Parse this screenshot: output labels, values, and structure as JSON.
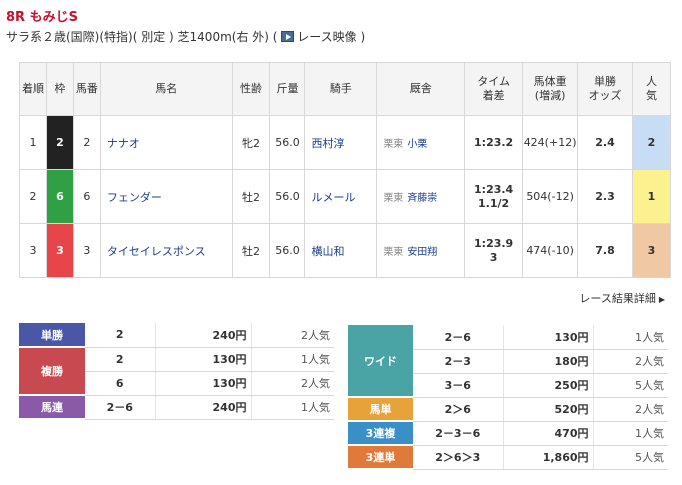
{
  "race": {
    "title": "8R もみじS",
    "conditions": "サラ系２歳(国際)(特指)( 別定 ) 芝1400m(右 外)  (",
    "video_label": "レース映像",
    "conditions_close": " )"
  },
  "table": {
    "headers": {
      "rank": "着順",
      "waku": "枠",
      "umaban": "馬番",
      "name": "馬名",
      "sexage": "性齢",
      "weight": "斤量",
      "jockey": "騎手",
      "trainer": "厩舎",
      "time1": "タイム",
      "time2": "着差",
      "bodyweight1": "馬体重",
      "bodyweight2": "(増減)",
      "odds1": "単勝",
      "odds2": "オッズ",
      "pop1": "人",
      "pop2": "気"
    },
    "rows": [
      {
        "rank": "1",
        "waku": "2",
        "waku_color": "#222222",
        "umaban": "2",
        "name": "ナナオ",
        "sexage": "牝2",
        "weight": "56.0",
        "jockey": "西村淳",
        "belong": "栗東",
        "trainer": "小栗",
        "time": "1:23.2",
        "margin": "",
        "bodyweight": "424(+12)",
        "odds": "2.4",
        "pop": "2",
        "pop_bg": "#c7dcf5"
      },
      {
        "rank": "2",
        "waku": "6",
        "waku_color": "#2fa043",
        "umaban": "6",
        "name": "フェンダー",
        "sexage": "牡2",
        "weight": "56.0",
        "jockey": "ルメール",
        "belong": "栗東",
        "trainer": "斉藤崇",
        "time": "1:23.4",
        "margin": "1.1/2",
        "bodyweight": "504(-12)",
        "odds": "2.3",
        "pop": "1",
        "pop_bg": "#fbf18f"
      },
      {
        "rank": "3",
        "waku": "3",
        "waku_color": "#e8454b",
        "umaban": "3",
        "name": "タイセイレスポンス",
        "sexage": "牡2",
        "weight": "56.0",
        "jockey": "横山和",
        "belong": "栗東",
        "trainer": "安田翔",
        "time": "1:23.9",
        "margin": "3",
        "bodyweight": "474(-10)",
        "odds": "7.8",
        "pop": "3",
        "pop_bg": "#f0c8a4"
      }
    ]
  },
  "detail_link": "レース結果詳細",
  "payouts_left": [
    {
      "kind": "単勝",
      "color": "#4a57a6",
      "entries": [
        {
          "num": "2",
          "yen": "240円",
          "ninki": "2人気"
        }
      ]
    },
    {
      "kind": "複勝",
      "color": "#c8494f",
      "entries": [
        {
          "num": "2",
          "yen": "130円",
          "ninki": "1人気"
        },
        {
          "num": "6",
          "yen": "130円",
          "ninki": "2人気"
        }
      ]
    },
    {
      "kind": "馬連",
      "color": "#8a5aa8",
      "entries": [
        {
          "num": "2－6",
          "yen": "240円",
          "ninki": "1人気"
        }
      ]
    }
  ],
  "payouts_right": [
    {
      "kind": "ワイド",
      "color": "#4aa3a5",
      "entries": [
        {
          "num": "2－6",
          "yen": "130円",
          "ninki": "1人気"
        },
        {
          "num": "2－3",
          "yen": "180円",
          "ninki": "2人気"
        },
        {
          "num": "3－6",
          "yen": "250円",
          "ninki": "5人気"
        }
      ]
    },
    {
      "kind": "馬単",
      "color": "#e8a23a",
      "entries": [
        {
          "num": "2＞6",
          "yen": "520円",
          "ninki": "2人気"
        }
      ]
    },
    {
      "kind": "3連複",
      "color": "#3a8fc8",
      "entries": [
        {
          "num": "2－3－6",
          "yen": "470円",
          "ninki": "1人気"
        }
      ]
    },
    {
      "kind": "3連単",
      "color": "#e07a3a",
      "entries": [
        {
          "num": "2＞6＞3",
          "yen": "1,860円",
          "ninki": "5人気"
        }
      ]
    }
  ]
}
